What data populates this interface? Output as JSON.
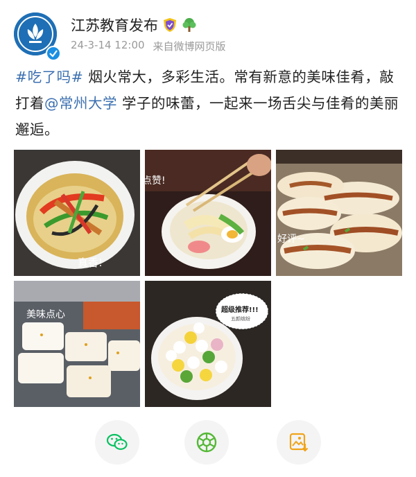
{
  "post": {
    "author": "江苏教育发布",
    "date": "24-3-14 12:00",
    "source": "来自微博网页版",
    "hashtag": "#吃了吗#",
    "text_1": " 烟火常大，多彩生活。常有新意的美味佳肴，敲打着",
    "mention": "@常州大学",
    "text_2": " 学子的味蕾，一起来一场舌尖与佳肴的美丽邂逅。"
  },
  "photos": {
    "photo1_sticker": "真香!",
    "photo2_sticker": "点赞!",
    "photo3_sticker": "好评~",
    "photo4_sticker": "美味点心",
    "photo5_sticker": "超级推荐!!!",
    "photo5_sticker_sub": "五颜缤纷"
  },
  "colors": {
    "wechat": "#07c160",
    "moments": "#55b837",
    "save": "#f0a31a",
    "link": "#3b6fb0"
  },
  "icons": [
    "wechat-icon",
    "moments-icon",
    "save-image-icon",
    "verified-icon",
    "shield-badge-icon",
    "tree-badge-icon"
  ]
}
